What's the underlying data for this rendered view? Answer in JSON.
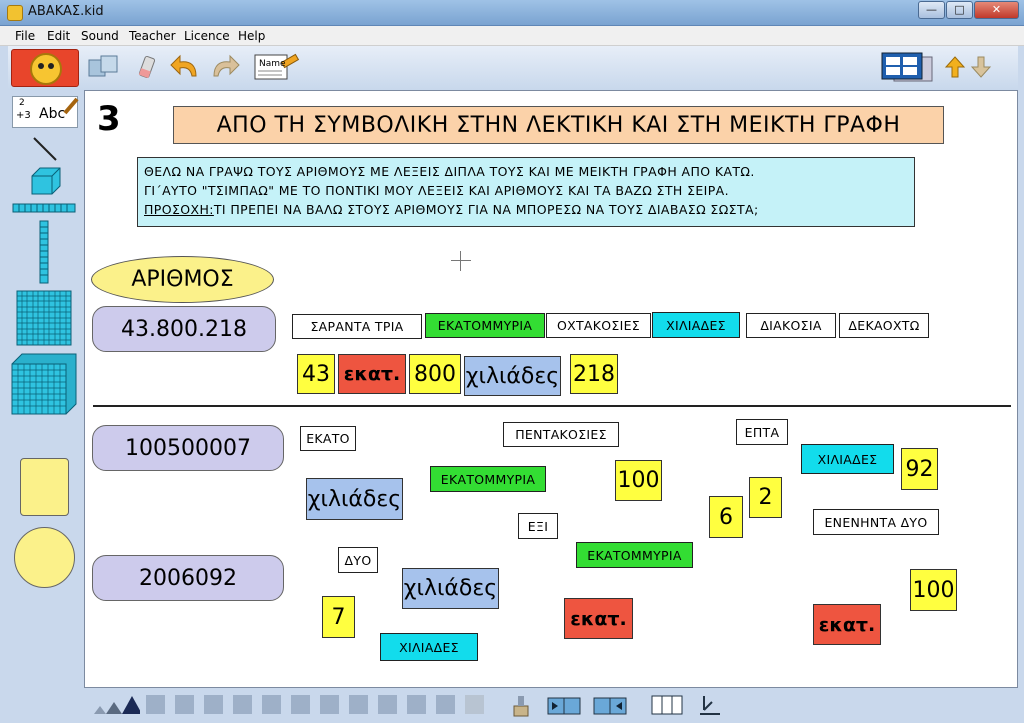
{
  "window": {
    "title": "ABAKAΣ.kid",
    "controls": [
      "—",
      "□",
      "✕"
    ]
  },
  "menu": [
    "File",
    "Edit",
    "Sound",
    "Teacher",
    "Licence",
    "Help"
  ],
  "toolbar": {
    "name_tag": "Name"
  },
  "palette": {
    "abc_tool_text": "Abc",
    "abc_tool_numbers": "+3",
    "abc_tool_top": "2"
  },
  "page": {
    "number": "3",
    "title": "ΑΠΟ ΤΗ ΣΥΜΒΟΛΙΚΗ ΣΤΗΝ ΛΕΚΤΙΚΗ ΚΑΙ ΣΤΗ ΜΕΙΚΤΗ ΓΡΑΦΗ",
    "instructions": {
      "line1": "ΘΕΛΩ ΝΑ ΓΡΑΨΩ ΤΟΥΣ ΑΡΙΘΜΟΥΣ ΜΕ ΛΕΞΕΙΣ ΔΙΠΛΑ ΤΟΥΣ ΚΑΙ ΜΕ ΜΕΙΚΤΗ ΓΡΑΦΗ ΑΠΟ ΚΑΤΩ.",
      "line2": "ΓΙ΄ΑΥΤΟ \"ΤΣΙΜΠΑΩ\" ΜΕ ΤΟ ΠΟΝΤΙΚΙ ΜΟΥ ΛΕΞΕΙΣ ΚΑΙ ΑΡΙΘΜΟΥΣ ΚΑΙ ΤΑ ΒΑΖΩ ΣΤΗ ΣΕΙΡΑ.",
      "line3_label": "ΠΡΟΣΟΧΗ:",
      "line3_text": "ΤΙ ΠΡΕΠΕΙ ΝΑ ΒΑΛΩ ΣΤΟΥΣ ΑΡΙΘΜΟΥΣ ΓΙΑ ΝΑ ΜΠΟΡΕΣΩ ΝΑ ΤΟΥΣ ΔΙΑΒΑΣΩ ΣΩΣΤΑ;"
    },
    "header_label": "ΑΡΙΘΜΟΣ",
    "numbers": [
      "43.800.218",
      "100500007",
      "2006092"
    ],
    "row1_words": [
      "ΣΑΡΑΝΤΑ ΤΡΙΑ",
      "ΕΚΑΤΟΜΜΥΡΙΑ",
      "ΟΧΤΑΚΟΣΙΕΣ",
      "ΧΙΛΙΑΔΕΣ",
      "ΔΙΑΚΟΣΙΑ",
      "ΔΕΚΑΟΧΤΩ"
    ],
    "row1_tiles": [
      "43",
      "εκατ.",
      "800",
      "χιλιάδες",
      "218"
    ],
    "scatter": {
      "ekato": "ΕΚΑΤΟ",
      "pentakosies": "ΠΕΝΤΑΚΟΣΙΕΣ",
      "epta": "ΕΠΤΑ",
      "xiliades1": "ΧΙΛΙΑΔΕΣ",
      "n92": "92",
      "xil_tile1": "χιλιάδες",
      "ekatommyria1": "ΕΚΑΤΟΜΜΥΡΙΑ",
      "n100a": "100",
      "n2": "2",
      "n6": "6",
      "exi": "ΕΞΙ",
      "eneninta": "ΕΝΕΝΗΝΤΑ ΔΥΟ",
      "dyo": "ΔΥΟ",
      "ekatommyria2": "ΕΚΑΤΟΜΜΥΡΙΑ",
      "xil_tile2": "χιλιάδες",
      "n7": "7",
      "ekat1": "εκατ.",
      "xiliades2": "ΧΙΛΙΑΔΕΣ",
      "n100b": "100",
      "ekat2": "εκατ."
    }
  },
  "colors": {
    "title_bg": "#fbd2a9",
    "instr_bg": "#c5f2f8",
    "number_box": "#cdcbec",
    "yellow_tile": "#ffff40",
    "ekat_tile": "#ee5540",
    "xil_tile": "#a6c2ec",
    "green_word": "#33dd33",
    "cyan_word": "#12dcec"
  }
}
